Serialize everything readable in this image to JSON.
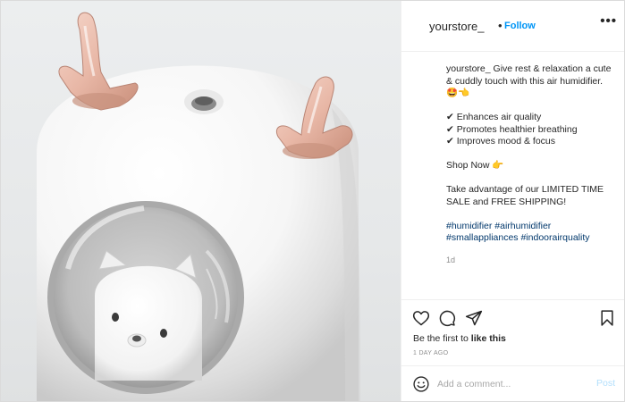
{
  "header": {
    "username": "yourstore_",
    "separator": "•",
    "follow_label": "Follow",
    "more_label": "•••"
  },
  "caption": {
    "username": "yourstore_",
    "intro": "Give rest & relaxation a cute & cuddly touch with this air humidifier. 🤩👈",
    "benefits": [
      "✔ Enhances air quality",
      "✔ Promotes healthier breathing",
      "✔ Improves mood & focus"
    ],
    "cta": "Shop Now 👉",
    "offer": "Take advantage of our LIMITED TIME SALE and FREE SHIPPING!",
    "hashtags_line1": "#humidifier #airhumidifier",
    "hashtags_line2": "#smallappliances #indoorairquality",
    "time_ago": "1d"
  },
  "actions": {
    "icons": [
      "heart-icon",
      "comment-icon",
      "share-icon",
      "bookmark-icon"
    ],
    "likes_prefix": "Be the first to ",
    "likes_bold": "like this",
    "posted_date": "1 DAY AGO"
  },
  "comment": {
    "placeholder": "Add a comment...",
    "post_label": "Post",
    "emoji_icon": "smiley-icon"
  },
  "colors": {
    "accent": "#0095f6",
    "hashtag": "#00376b",
    "muted": "#8e8e8e",
    "post_disabled": "#b2dffc",
    "antler": "#e8b7a6"
  }
}
